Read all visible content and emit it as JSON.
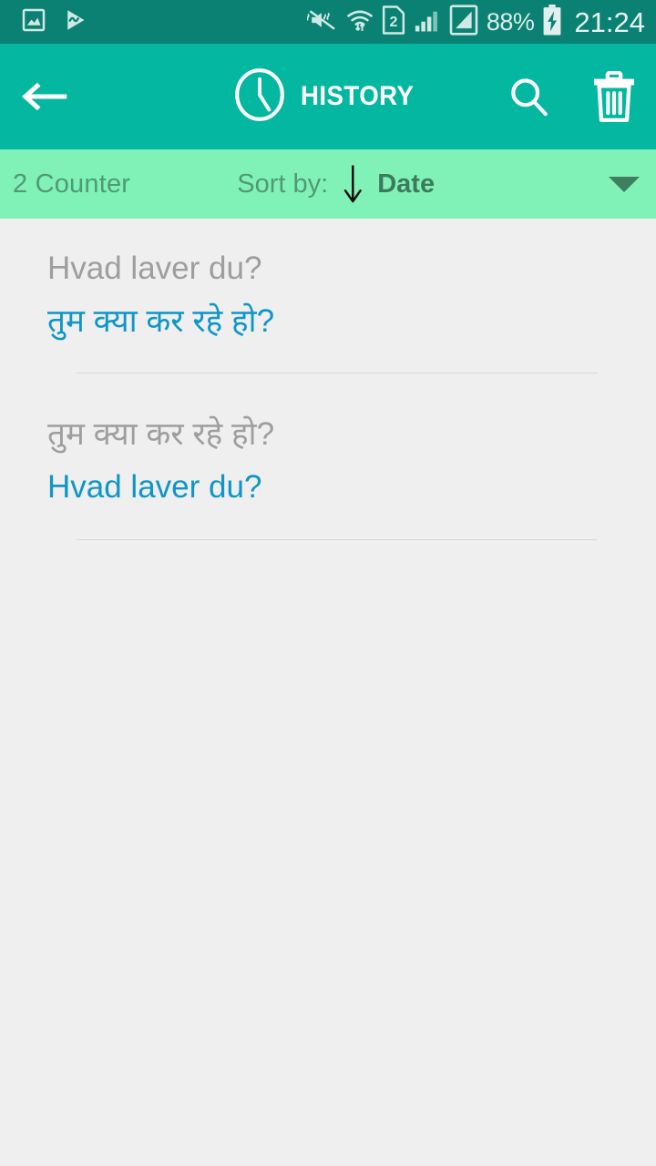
{
  "status_bar": {
    "background_color": "#0b8174",
    "left_icons": [
      {
        "name": "screenshot-icon",
        "label": "Screenshot captured"
      },
      {
        "name": "media-play-icon",
        "label": "Media player"
      }
    ],
    "right_icons": [
      {
        "name": "volume-mute-vibrate-icon",
        "label": "Silent with vibrate"
      },
      {
        "name": "wifi-transfer-icon",
        "label": "Wi-Fi connected"
      },
      {
        "name": "sim-2-icon",
        "label": "SIM 2"
      },
      {
        "name": "signal-bars-icon",
        "label": "Mobile signal"
      },
      {
        "name": "mobile-data-icon",
        "label": "Mobile data"
      }
    ],
    "battery_percent": "88%",
    "battery_icon": "battery-charging-icon",
    "clock": "21:24"
  },
  "action_bar": {
    "background_color": "#04b7a0",
    "back_icon": "arrow-left-icon",
    "clock_icon": "clock-icon",
    "title": "HISTORY",
    "search_icon": "search-icon",
    "delete_icon": "trash-icon"
  },
  "sort_bar": {
    "background_color": "#80f2b8",
    "counter": "2 Counter",
    "sort_label": "Sort by:",
    "sort_direction_icon": "arrow-down-icon",
    "sort_value": "Date",
    "dropdown_icon": "chevron-down-icon"
  },
  "history": {
    "items": [
      {
        "source_text": "Hvad laver du?",
        "target_text": "तुम क्या कर रहे हो?"
      },
      {
        "source_text": "तुम क्या कर रहे हो?",
        "target_text": "Hvad laver du?"
      }
    ]
  },
  "colors": {
    "status_bar": "#0b8174",
    "accent": "#04b7a0",
    "sort_bar": "#80f2b8",
    "page_background": "#efefef",
    "source_text": "#9e9e9e",
    "target_text": "#0f96c8"
  }
}
